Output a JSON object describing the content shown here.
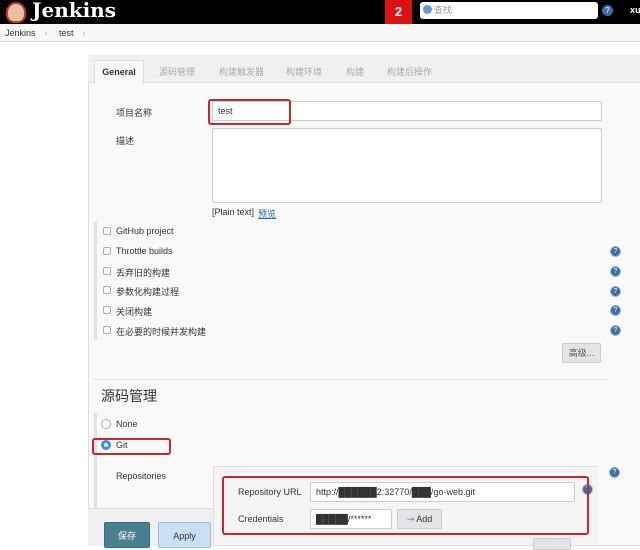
{
  "header": {
    "title": "Jenkins",
    "notification_count": "2",
    "search_placeholder": "查找",
    "help": "?",
    "user": "xu"
  },
  "breadcrumb": [
    "Jenkins",
    "test"
  ],
  "tabs": [
    {
      "label": "General"
    },
    {
      "label": "源码管理"
    },
    {
      "label": "构建触发器"
    },
    {
      "label": "构建环境"
    },
    {
      "label": "构建"
    },
    {
      "label": "构建后操作"
    }
  ],
  "general": {
    "name_label": "项目名称",
    "name_value": "test",
    "desc_label": "描述",
    "desc_value": "",
    "plain_text": "[Plain text]",
    "preview": "预览",
    "options": [
      {
        "label": "GitHub project",
        "checked": false,
        "help": false
      },
      {
        "label": "Throttle builds",
        "checked": false,
        "help": true
      },
      {
        "label": "丢弃旧的构建",
        "checked": false,
        "help": true
      },
      {
        "label": "参数化构建过程",
        "checked": false,
        "help": true
      },
      {
        "label": "关闭构建",
        "checked": false,
        "help": true
      },
      {
        "label": "在必要的时候并发构建",
        "checked": false,
        "help": true
      }
    ],
    "advanced": "高级..."
  },
  "scm": {
    "title": "源码管理",
    "options": [
      {
        "label": "None",
        "selected": false
      },
      {
        "label": "Git",
        "selected": true
      }
    ],
    "repositories_label": "Repositories",
    "repo_url_label": "Repository URL",
    "repo_url_value": "http://██████2:32770/███/go-web.git",
    "credentials_label": "Credentials",
    "credentials_value": "█████/******",
    "add_button": "Add"
  },
  "footer": {
    "save": "保存",
    "apply": "Apply"
  },
  "colors": {
    "highlight": "#c8262f",
    "save": "#4a7f8f",
    "apply": "#c9dff2"
  }
}
